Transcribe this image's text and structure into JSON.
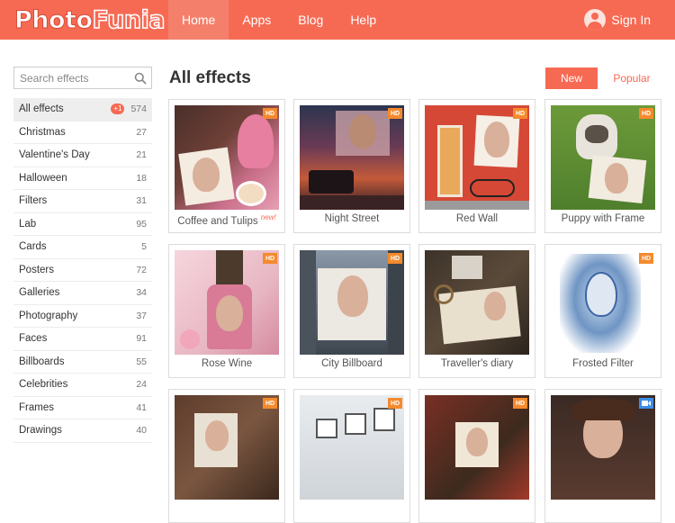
{
  "header": {
    "logo_part1": "Photo",
    "logo_part2": "Funia",
    "nav": [
      "Home",
      "Apps",
      "Blog",
      "Help"
    ],
    "signin": "Sign In"
  },
  "sidebar": {
    "search_placeholder": "Search effects",
    "categories": [
      {
        "label": "All effects",
        "badge": "+1",
        "count": "574"
      },
      {
        "label": "Christmas",
        "count": "27"
      },
      {
        "label": "Valentine's Day",
        "count": "21"
      },
      {
        "label": "Halloween",
        "count": "18"
      },
      {
        "label": "Filters",
        "count": "31"
      },
      {
        "label": "Lab",
        "count": "95"
      },
      {
        "label": "Cards",
        "count": "5"
      },
      {
        "label": "Posters",
        "count": "72"
      },
      {
        "label": "Galleries",
        "count": "34"
      },
      {
        "label": "Photography",
        "count": "37"
      },
      {
        "label": "Faces",
        "count": "91"
      },
      {
        "label": "Billboards",
        "count": "55"
      },
      {
        "label": "Celebrities",
        "count": "24"
      },
      {
        "label": "Frames",
        "count": "41"
      },
      {
        "label": "Drawings",
        "count": "40"
      }
    ]
  },
  "main": {
    "title": "All effects",
    "btn_new": "New",
    "btn_popular": "Popular",
    "hd_label": "HD",
    "new_tag": "new!",
    "effects": [
      {
        "label": "Coffee and Tulips",
        "is_new": true
      },
      {
        "label": "Night Street"
      },
      {
        "label": "Red Wall"
      },
      {
        "label": "Puppy with Frame"
      },
      {
        "label": "Rose Wine"
      },
      {
        "label": "City Billboard"
      },
      {
        "label": "Traveller's diary"
      },
      {
        "label": "Frosted Filter"
      }
    ]
  },
  "colors": {
    "brand": "#f66a54",
    "hd_badge": "#f48a2d",
    "video_badge": "#3a8ee6"
  }
}
